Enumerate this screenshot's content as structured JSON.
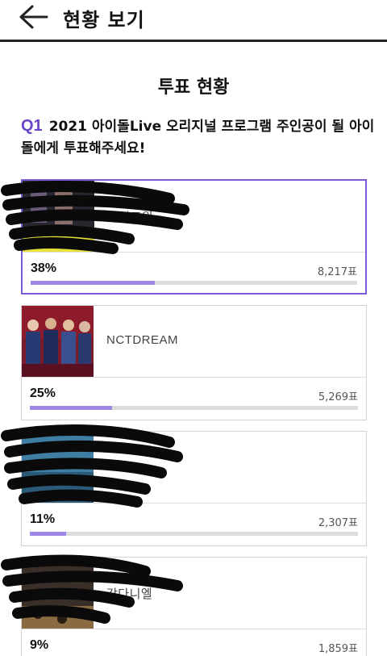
{
  "header": {
    "title": "현황 보기",
    "back_icon": "arrow-left-icon"
  },
  "section_title": "투표 현황",
  "question": {
    "number": "Q1",
    "text": "2021 아이돌Live 오리지널 프로그램 주인공이 될 아이돌에게 투표해주세요!"
  },
  "accent_color": "#6a45c9",
  "bar_color": "#9c86e6",
  "candidates": [
    {
      "name": "아이즈원",
      "percent_label": "38%",
      "votes_label": "8,217표",
      "fraction": 0.38,
      "selected": true
    },
    {
      "name": "NCTDREAM",
      "percent_label": "25%",
      "votes_label": "5,269표",
      "fraction": 0.25,
      "selected": false
    },
    {
      "name": "",
      "percent_label": "11%",
      "votes_label": "2,307표",
      "fraction": 0.11,
      "selected": false
    },
    {
      "name": "강다니엘",
      "percent_label": "9%",
      "votes_label": "1,859표",
      "fraction": 0.09,
      "selected": false
    }
  ]
}
